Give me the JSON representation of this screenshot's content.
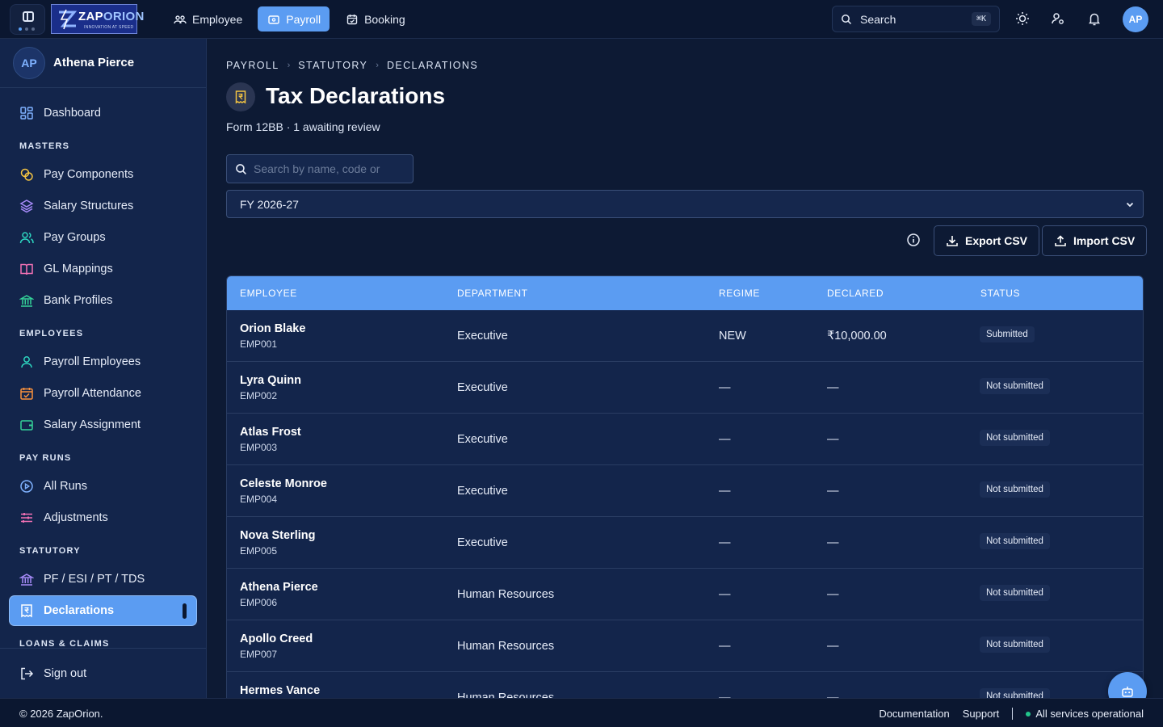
{
  "topbar": {
    "brand": {
      "name_prefix": "ZAP",
      "name_suffix": "ORION",
      "tagline": "INNOVATION AT SPEED"
    },
    "nav": [
      {
        "label": "Employee",
        "icon": "users-icon",
        "active": false
      },
      {
        "label": "Payroll",
        "icon": "wallet-icon",
        "active": true
      },
      {
        "label": "Booking",
        "icon": "calendar-icon",
        "active": false
      }
    ],
    "search": {
      "label": "Search",
      "shortcut": "⌘K"
    },
    "user_initials": "AP"
  },
  "sidebar": {
    "user": {
      "initials": "AP",
      "name": "Athena Pierce"
    },
    "dashboard": "Dashboard",
    "sections": {
      "masters": "MASTERS",
      "employees": "EMPLOYEES",
      "pay_runs": "PAY RUNS",
      "statutory": "STATUTORY",
      "loans_claims": "LOANS & CLAIMS"
    },
    "items": {
      "pay_components": "Pay Components",
      "salary_structures": "Salary Structures",
      "pay_groups": "Pay Groups",
      "gl_mappings": "GL Mappings",
      "bank_profiles": "Bank Profiles",
      "payroll_employees": "Payroll Employees",
      "payroll_attendance": "Payroll Attendance",
      "salary_assignment": "Salary Assignment",
      "all_runs": "All Runs",
      "adjustments": "Adjustments",
      "pf_esi": "PF / ESI / PT / TDS",
      "declarations": "Declarations"
    },
    "sign_out": "Sign out"
  },
  "main": {
    "breadcrumb": [
      "PAYROLL",
      "STATUTORY",
      "DECLARATIONS"
    ],
    "title": "Tax Declarations",
    "subtitle": "Form 12BB · 1 awaiting review",
    "search_placeholder": "Search by name, code or",
    "fiscal_year": "FY 2026-27",
    "export_label": "Export CSV",
    "import_label": "Import CSV",
    "columns": {
      "employee": "EMPLOYEE",
      "department": "DEPARTMENT",
      "regime": "REGIME",
      "declared": "DECLARED",
      "status": "STATUS"
    },
    "rows": [
      {
        "name": "Orion Blake",
        "code": "EMP001",
        "department": "Executive",
        "regime": "NEW",
        "declared": "₹10,000.00",
        "status": "Submitted"
      },
      {
        "name": "Lyra Quinn",
        "code": "EMP002",
        "department": "Executive",
        "regime": "—",
        "declared": "—",
        "status": "Not submitted"
      },
      {
        "name": "Atlas Frost",
        "code": "EMP003",
        "department": "Executive",
        "regime": "—",
        "declared": "—",
        "status": "Not submitted"
      },
      {
        "name": "Celeste Monroe",
        "code": "EMP004",
        "department": "Executive",
        "regime": "—",
        "declared": "—",
        "status": "Not submitted"
      },
      {
        "name": "Nova Sterling",
        "code": "EMP005",
        "department": "Executive",
        "regime": "—",
        "declared": "—",
        "status": "Not submitted"
      },
      {
        "name": "Athena Pierce",
        "code": "EMP006",
        "department": "Human Resources",
        "regime": "—",
        "declared": "—",
        "status": "Not submitted"
      },
      {
        "name": "Apollo Creed",
        "code": "EMP007",
        "department": "Human Resources",
        "regime": "—",
        "declared": "—",
        "status": "Not submitted"
      },
      {
        "name": "Hermes Vance",
        "code": "",
        "department": "Human Resources",
        "regime": "—",
        "declared": "—",
        "status": "Not submitted"
      }
    ]
  },
  "footer": {
    "copyright": "© 2026 ZapOrion.",
    "documentation": "Documentation",
    "support": "Support",
    "status": "All services operational"
  },
  "colors": {
    "accent": "#5b9cf2",
    "status_ok": "#22c58b",
    "sidebar_bg": "#13254b",
    "page_bg": "#0d1a34"
  }
}
